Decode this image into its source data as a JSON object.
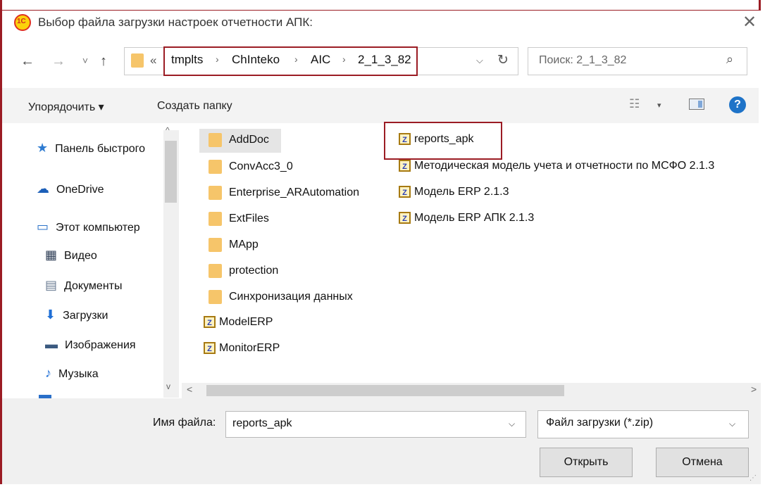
{
  "window": {
    "title": "Выбор файла загрузки настроек отчетности АПК:",
    "close_glyph": "✕"
  },
  "nav": {
    "back_glyph": "←",
    "forward_glyph": "→",
    "recent_glyph": "˅",
    "up_glyph": "↑",
    "overflow_glyph": "«",
    "breadcrumbs": [
      "tmplts",
      "ChInteko",
      "AIC",
      "2_1_3_82"
    ],
    "separator": "›",
    "dropdown_glyph": "⌵",
    "refresh_glyph": "↻"
  },
  "search": {
    "placeholder": "Поиск: 2_1_3_82",
    "icon_glyph": "⌕"
  },
  "toolbar": {
    "organize_label": "Упорядочить ▾",
    "new_folder_label": "Создать папку",
    "views_glyph": "☷",
    "views_dropdown": "▾",
    "help_glyph": "?"
  },
  "sidebar": {
    "items": [
      {
        "label": "Панель быстрого",
        "icon": "star-icon",
        "glyph": "★",
        "color": "#2e7bd1"
      },
      {
        "label": "OneDrive",
        "icon": "cloud-icon",
        "glyph": "☁",
        "color": "#1c5fb8"
      },
      {
        "label": "Этот компьютер",
        "icon": "computer-icon",
        "glyph": "▭",
        "color": "#2b72c8"
      },
      {
        "label": "Видео",
        "icon": "video-icon",
        "glyph": "▦",
        "color": "#2f3e56"
      },
      {
        "label": "Документы",
        "icon": "document-icon",
        "glyph": "▤",
        "color": "#6b7c93"
      },
      {
        "label": "Загрузки",
        "icon": "download-icon",
        "glyph": "⬇",
        "color": "#1f6fd6"
      },
      {
        "label": "Изображения",
        "icon": "pictures-icon",
        "glyph": "▬",
        "color": "#3b5a80"
      },
      {
        "label": "Музыка",
        "icon": "music-icon",
        "glyph": "♪",
        "color": "#1f6fd6"
      }
    ],
    "scroll_up": "^",
    "scroll_down": "v"
  },
  "files": {
    "column1": [
      {
        "name": "AddDoc",
        "type": "folder"
      },
      {
        "name": "ConvAcc3_0",
        "type": "folder"
      },
      {
        "name": "Enterprise_ARAutomation",
        "type": "folder"
      },
      {
        "name": "ExtFiles",
        "type": "folder"
      },
      {
        "name": "MApp",
        "type": "folder"
      },
      {
        "name": "protection",
        "type": "folder"
      },
      {
        "name": "Синхронизация данных",
        "type": "folder"
      },
      {
        "name": "ModelERP",
        "type": "zip"
      },
      {
        "name": "MonitorERP",
        "type": "zip"
      }
    ],
    "column2": [
      {
        "name": "reports_apk",
        "type": "zip"
      },
      {
        "name": "Методическая модель учета и отчетности по МСФО 2.1.3",
        "type": "zip"
      },
      {
        "name": "Модель ERP 2.1.3",
        "type": "zip"
      },
      {
        "name": "Модель ERP АПК 2.1.3",
        "type": "zip"
      }
    ],
    "zip_glyph": "Z",
    "hscroll_left": "<",
    "hscroll_right": ">"
  },
  "bottom": {
    "filename_label": "Имя файла:",
    "filename_value": "reports_apk",
    "filetype_value": "Файл загрузки (*.zip)",
    "dropdown_glyph": "⌵",
    "open_label": "Открыть",
    "cancel_label": "Отмена"
  },
  "colors": {
    "highlight_border": "#9b1c24",
    "folder": "#f6c56a",
    "selected_bg": "#e5e5e5"
  }
}
